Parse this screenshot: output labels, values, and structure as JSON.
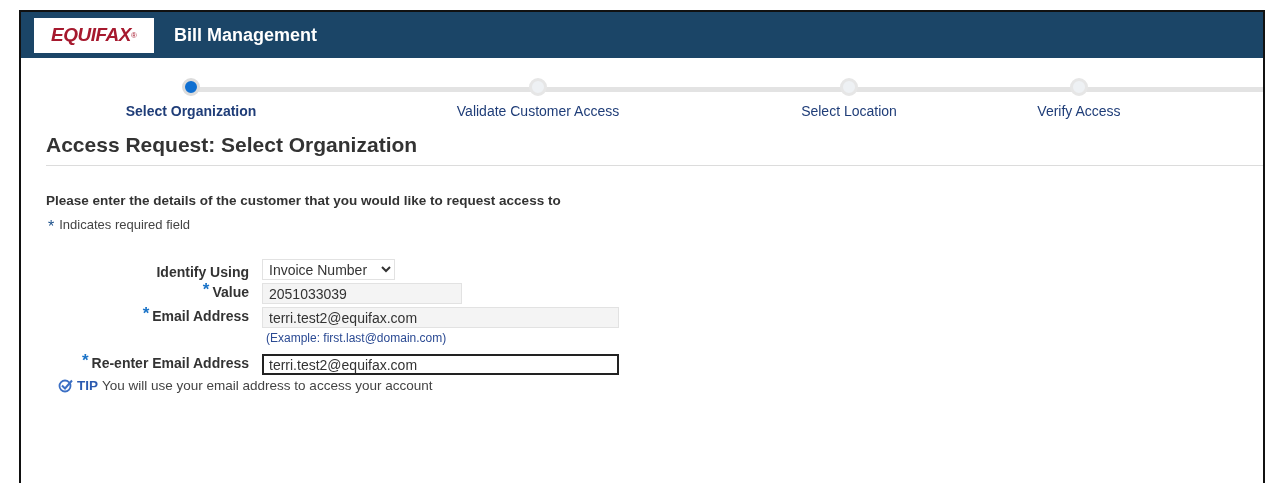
{
  "header": {
    "logo": "EQUIFAX",
    "logo_mark": "®",
    "title": "Bill Management"
  },
  "steps": [
    {
      "label": "Select Organization",
      "selected": true
    },
    {
      "label": "Validate Customer Access",
      "selected": false
    },
    {
      "label": "Select Location",
      "selected": false
    },
    {
      "label": "Verify Access",
      "selected": false
    }
  ],
  "page_title": "Access Request: Select Organization",
  "instructions": "Please enter the details of the customer that you would like to request access to",
  "required_note": {
    "mark": "*",
    "text": "Indicates required field"
  },
  "fields": [
    {
      "kind": "select",
      "label": "Identify Using",
      "required": false,
      "value": "Invoice Number",
      "focused": false
    },
    {
      "kind": "text",
      "label": "Value",
      "required": true,
      "value": "2051033039",
      "focused": false
    },
    {
      "kind": "text",
      "label": "Email Address",
      "required": true,
      "value": "terri.test2@equifax.com",
      "focused": false,
      "hint": "(Example: first.last@domain.com)"
    },
    {
      "kind": "text",
      "label": "Re-enter Email Address",
      "required": true,
      "value": "terri.test2@equifax.com",
      "focused": true
    }
  ],
  "tip": {
    "label": "TIP",
    "text": "You will use your email address to access your account"
  }
}
